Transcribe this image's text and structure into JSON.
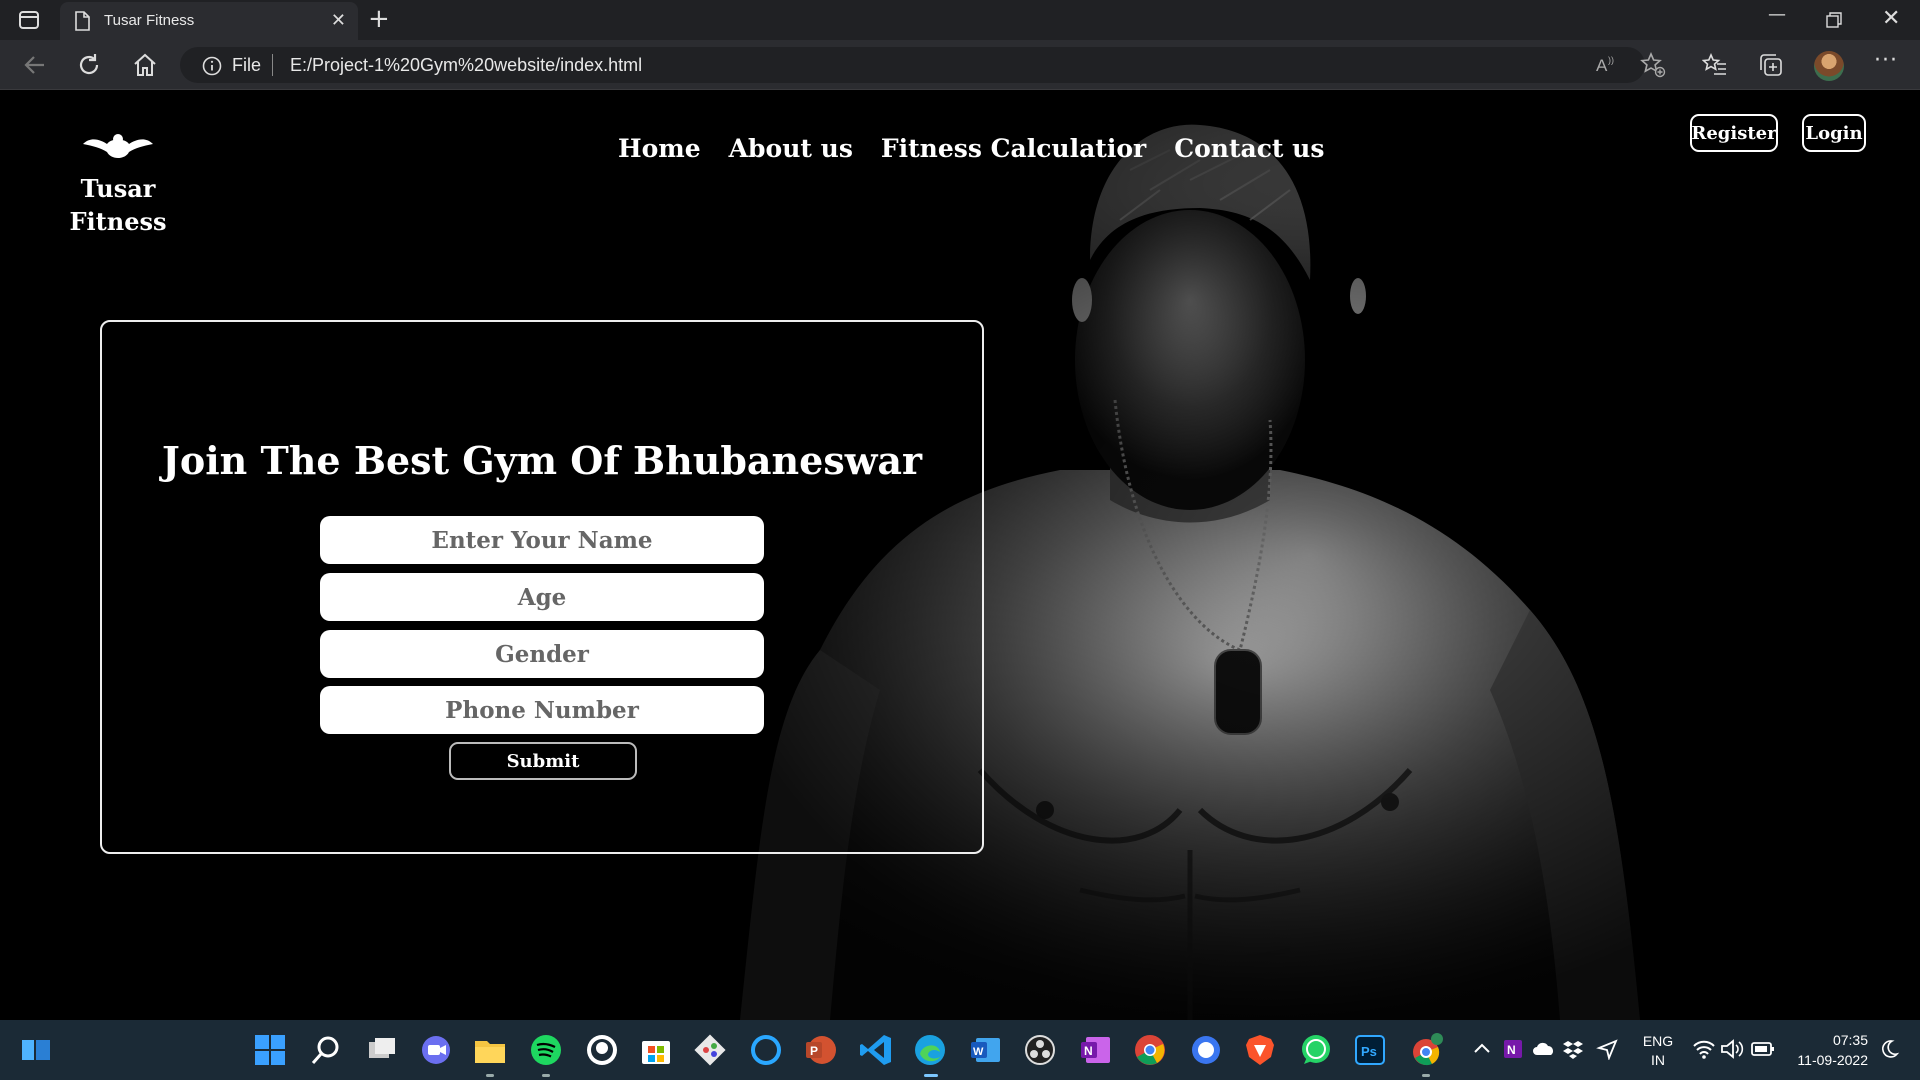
{
  "browser": {
    "tab_title": "Tusar Fitness",
    "url_scheme": "File",
    "url": "E:/Project-1%20Gym%20website/index.html"
  },
  "site": {
    "brand_line1": "Tusar",
    "brand_line2": "Fitness",
    "nav": [
      "Home",
      "About us",
      "Fitness Calculatior",
      "Contact us"
    ],
    "register_label": "Register",
    "login_label": "Login"
  },
  "form": {
    "heading": "Join The Best Gym Of Bhubaneswar",
    "name_placeholder": "Enter Your Name",
    "age_placeholder": "Age",
    "gender_placeholder": "Gender",
    "phone_placeholder": "Phone Number",
    "submit_label": "Submit"
  },
  "taskbar": {
    "lang_line1": "ENG",
    "lang_line2": "IN",
    "time": "07:35",
    "date": "11-09-2022",
    "apps": [
      "start",
      "search",
      "task-view",
      "chat",
      "file-explorer",
      "spotify",
      "github-desktop",
      "microsoft-store",
      "git",
      "cortana",
      "powerpoint",
      "vscode",
      "edge",
      "word",
      "obs",
      "onenote",
      "chrome",
      "signal",
      "brave",
      "whatsapp",
      "photoshop",
      "chrome-profile"
    ]
  },
  "colors": {
    "page_bg": "#000000",
    "tab_bar": "#202124",
    "toolbar": "#2b2c30",
    "taskbar": "#1b2a36"
  }
}
